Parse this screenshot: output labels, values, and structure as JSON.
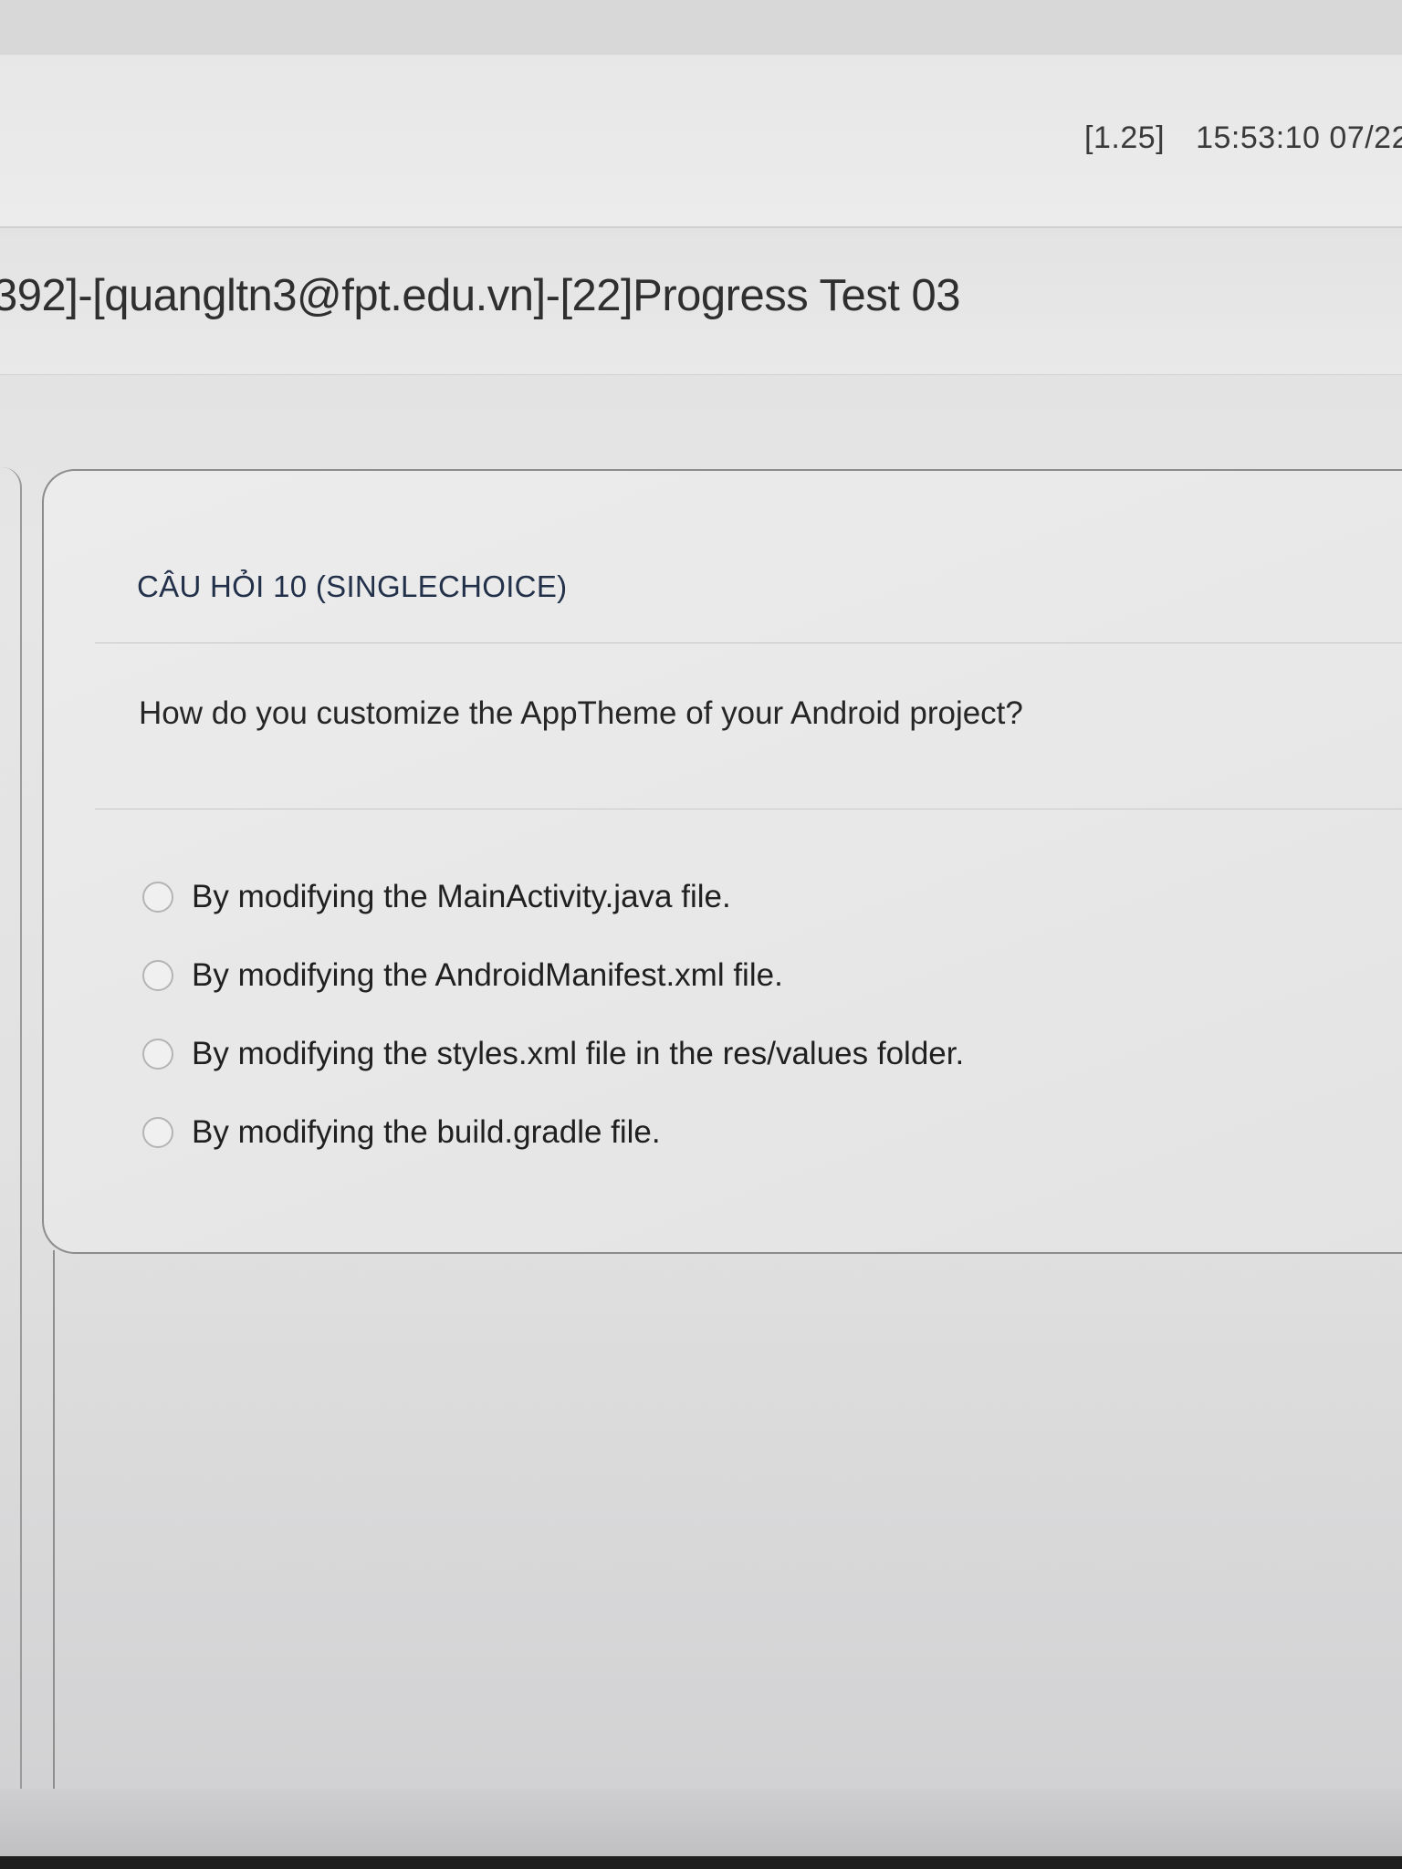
{
  "header": {
    "score": "[1.25]",
    "timestamp": "15:53:10 07/22"
  },
  "exam": {
    "title": "392]-[quangltn3@fpt.edu.vn]-[22]Progress Test 03"
  },
  "question": {
    "heading": "CÂU HỎI 10 (SINGLECHOICE)",
    "text": "How do you customize the AppTheme of your Android project?",
    "options": [
      {
        "label": "By modifying the MainActivity.java file."
      },
      {
        "label": "By modifying the AndroidManifest.xml file."
      },
      {
        "label": "By modifying the styles.xml file in the res/values folder."
      },
      {
        "label": "By modifying the build.gradle file."
      }
    ]
  }
}
